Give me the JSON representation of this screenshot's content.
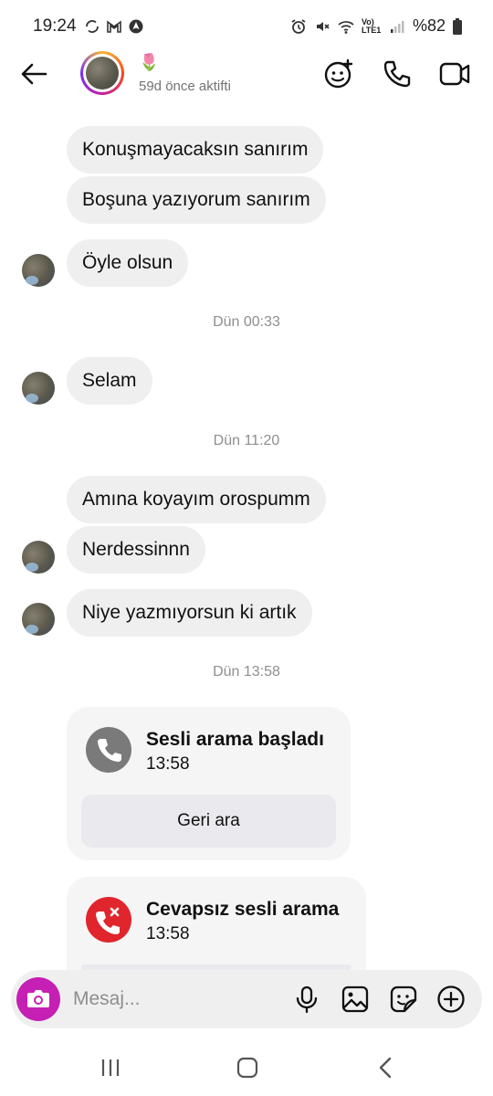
{
  "status_bar": {
    "time": "19:24",
    "battery": "%82",
    "network": "Vo) LTE1"
  },
  "header": {
    "status_emoji": "🌷",
    "status_text": "59d önce aktifti"
  },
  "messages": [
    {
      "text": "Konuşmayacaksın sanırım"
    },
    {
      "text": "Boşuna yazıyorum sanırım"
    },
    {
      "text": "Öyle olsun"
    },
    {
      "text": "Selam"
    },
    {
      "text": "Amına koyayım orospumm"
    },
    {
      "text": "Nerdessinnn"
    },
    {
      "text": "Niye yazmıyorsun ki artık"
    }
  ],
  "timestamps": [
    "Dün 00:33",
    "Dün 11:20",
    "Dün 13:58"
  ],
  "calls": [
    {
      "title": "Sesli arama başladı",
      "time": "13:58",
      "button": "Geri ara",
      "color": "#7a7a7a"
    },
    {
      "title": "Cevapsız sesli arama",
      "time": "13:58",
      "color": "#e0262c"
    }
  ],
  "composer": {
    "placeholder": "Mesaj..."
  },
  "colors": {
    "bubble_bg": "#efefef",
    "camera_button": "#c51fb3",
    "missed_call": "#e0262c"
  }
}
